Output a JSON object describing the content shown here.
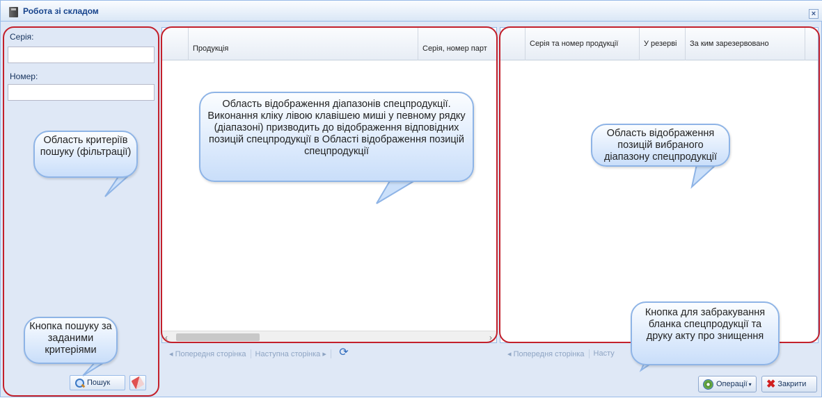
{
  "window": {
    "title": "Робота зі складом",
    "close_glyph": "×"
  },
  "filters": {
    "series_label": "Серія:",
    "series_value": "",
    "number_label": "Номер:",
    "number_value": "",
    "search_button": "Пошук"
  },
  "ranges_grid": {
    "columns": [
      "Продукція",
      "Серія, номер парт"
    ],
    "pager": {
      "prev": "Попередня сторінка",
      "next": "Наступна сторінка"
    }
  },
  "positions_grid": {
    "columns": [
      "Серія та номер продукції",
      "У резерві",
      "За ким зарезервовано"
    ],
    "pager": {
      "prev": "Попередня сторінка",
      "next": "Насту"
    }
  },
  "footer": {
    "operations_button": "Операції",
    "close_button": "Закрити"
  },
  "callouts": {
    "filter_area": "Область критеріїв пошуку (фільтрації)",
    "ranges_area": "Область відображення діапазонів спецпродукції. Виконання кліку лівою клавішею миші у певному рядку (діапазоні) призводить до відображення відповідних позицій спецпродукції в Області відображення позицій спецпродукції",
    "positions_area": "Область відображення позицій вибраного діапазону спецпродукції",
    "search_button_note": "Кнопка пошуку за заданими критеріями",
    "operations_note": "Кнопка для забракування бланка спецпродукції та друку акту про знищення"
  },
  "colors": {
    "highlight_ring": "#c3202b",
    "callout_border": "#8eb4e6",
    "window_bg": "#dfe8f6"
  },
  "icons": [
    "window-icon",
    "close-icon",
    "search-icon",
    "eraser-icon",
    "refresh-icon",
    "gear-icon",
    "close-x-icon"
  ]
}
